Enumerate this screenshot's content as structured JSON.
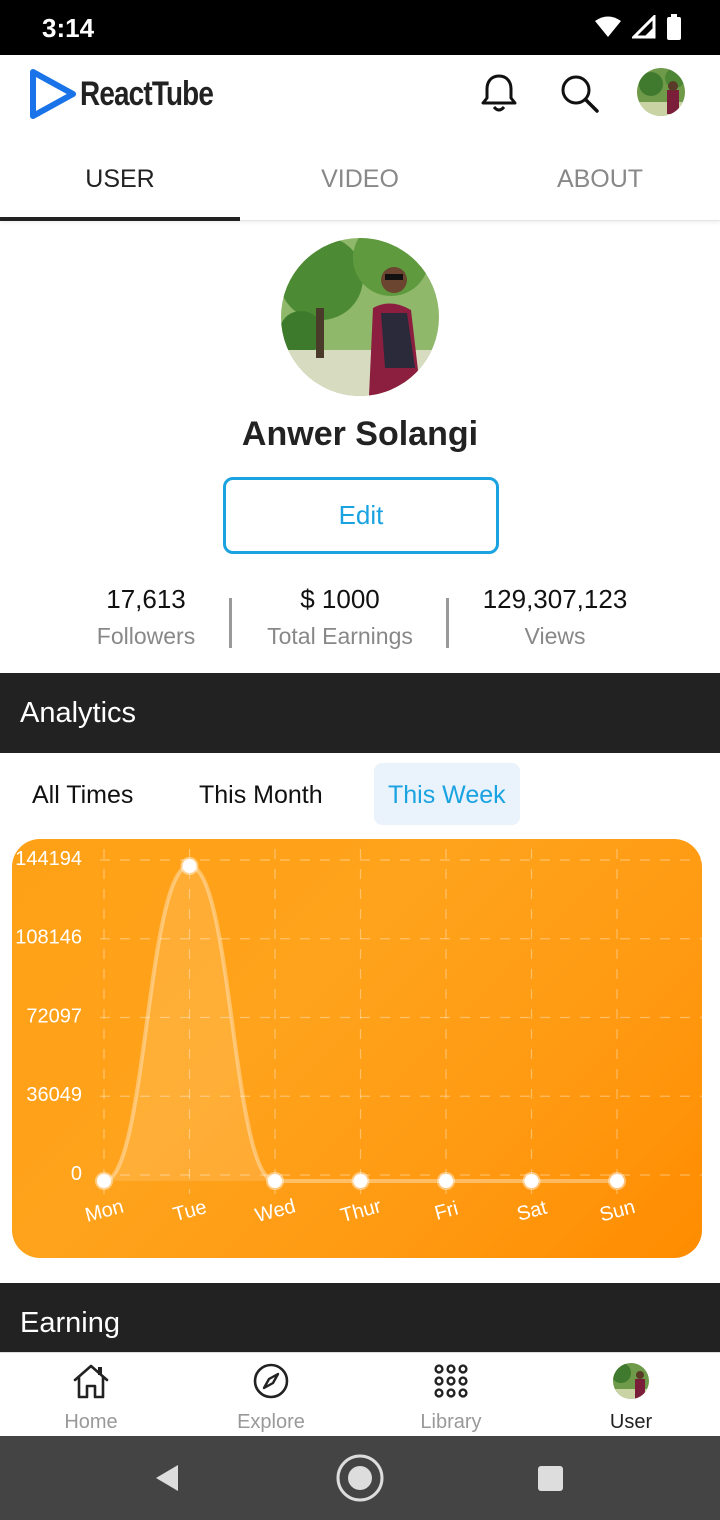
{
  "status_bar": {
    "time": "3:14"
  },
  "app": {
    "name": "ReactTube",
    "brand_color": "#1a73e8"
  },
  "header": {
    "icons": [
      "bell-icon",
      "search-icon",
      "avatar"
    ]
  },
  "tabs": [
    {
      "label": "USER",
      "active": true
    },
    {
      "label": "VIDEO",
      "active": false
    },
    {
      "label": "ABOUT",
      "active": false
    }
  ],
  "profile": {
    "name": "Anwer Solangi",
    "edit_label": "Edit"
  },
  "stats": [
    {
      "value": "17,613",
      "label": "Followers"
    },
    {
      "value": "$ 1000",
      "label": "Total Earnings"
    },
    {
      "value": "129,307,123",
      "label": "Views"
    }
  ],
  "analytics": {
    "title": "Analytics",
    "filters": [
      {
        "label": "All Times",
        "active": false
      },
      {
        "label": "This Month",
        "active": false
      },
      {
        "label": "This Week",
        "active": true
      }
    ]
  },
  "chart_data": {
    "type": "line",
    "x": [
      "Mon",
      "Tue",
      "Wed",
      "Thur",
      "Fri",
      "Sat",
      "Sun"
    ],
    "series": [
      {
        "values": [
          0,
          144194,
          0,
          0,
          0,
          0,
          0
        ]
      }
    ],
    "y_ticks": [
      "0",
      "36049",
      "72097",
      "108146",
      "144194"
    ],
    "ylim": [
      0,
      144194
    ],
    "title": "",
    "xlabel": "",
    "ylabel": "",
    "grid": true,
    "background_color": "#ffa31c",
    "line_color": "#ffffff"
  },
  "earning": {
    "title": "Earning"
  },
  "bottom_nav": [
    {
      "label": "Home",
      "icon": "home-icon",
      "active": false
    },
    {
      "label": "Explore",
      "icon": "compass-icon",
      "active": false
    },
    {
      "label": "Library",
      "icon": "grid-dots-icon",
      "active": false
    },
    {
      "label": "User",
      "icon": "avatar",
      "active": true
    }
  ]
}
